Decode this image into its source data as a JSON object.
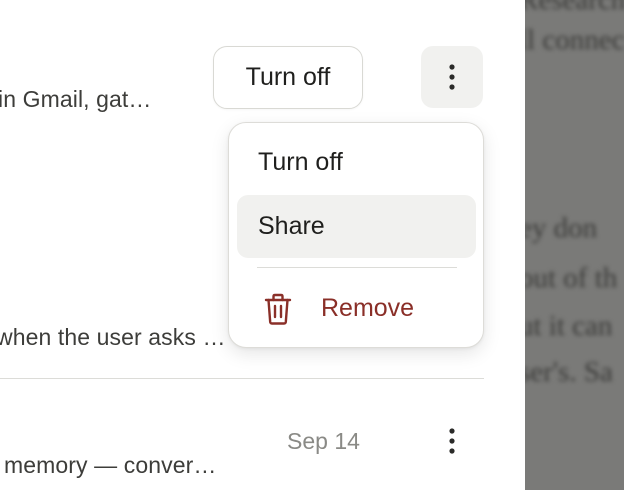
{
  "list": {
    "row1": {
      "description": "in Gmail, gat…",
      "turn_off_label": "Turn off"
    },
    "row2": {
      "description": "when the user asks …"
    },
    "row3": {
      "description": "memory — conver…",
      "date": "Sep 14"
    }
  },
  "menu": {
    "items": [
      {
        "label": "Turn off"
      },
      {
        "label": "Share",
        "hovered": true
      },
      {
        "label": "Remove",
        "icon": "trash-icon",
        "color": "#8a2f28"
      }
    ]
  },
  "document_pane": {
    "lines": [
      "Research",
      "ll connec",
      "ey don",
      "out of th",
      "ut it can",
      "ser's. Sa"
    ]
  },
  "colors": {
    "danger": "#8a2f28",
    "hover_bg": "#f1f1ef",
    "muted_text": "#8a8a86",
    "overlay": "#7a7a78"
  }
}
